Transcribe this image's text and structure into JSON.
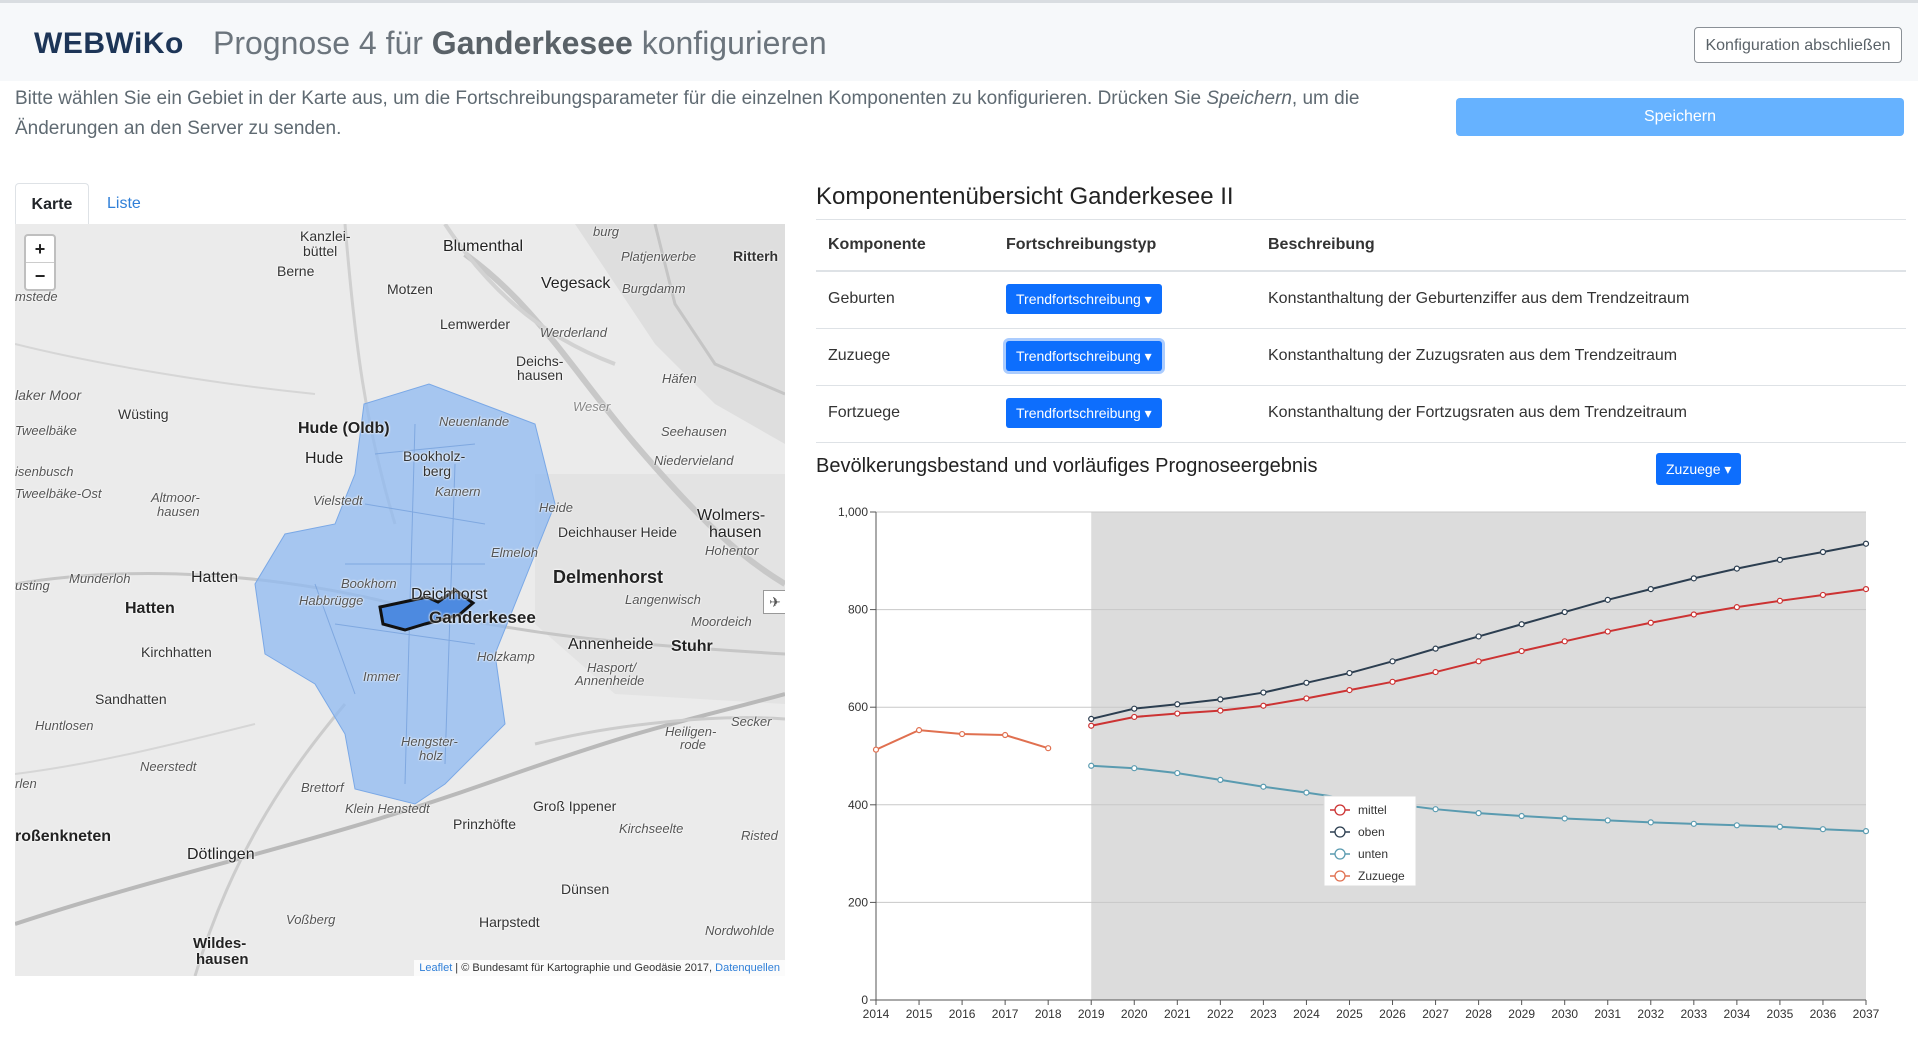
{
  "header": {
    "brand": "WEBWiKo",
    "title_prefix": "Prognose 4 für",
    "title_place": "Ganderkesee",
    "title_suffix": "konfigurieren",
    "finish_button": "Konfiguration abschließen"
  },
  "intro": {
    "line1": "Bitte wählen Sie ein Gebiet in der Karte aus, um die Fortschreibungsparameter für die einzelnen Komponenten zu konfigurieren. Drücken Sie ",
    "save_word": "Speichern",
    "line1_end": ", um die",
    "line2": "Änderungen an den Server zu senden."
  },
  "save_button": "Speichern",
  "tabs": [
    {
      "label": "Karte",
      "active": true
    },
    {
      "label": "Liste",
      "active": false
    }
  ],
  "map": {
    "zoom_in": "+",
    "zoom_out": "−",
    "labels": {
      "kanzleibuttel": "Kanzlei-",
      "kanzleibuttel2": "büttel",
      "burg": "burg",
      "blumenthal": "Blumenthal",
      "platjenwerbe": "Platjenwerbe",
      "ritterh": "Ritterh",
      "berne": "Berne",
      "motzen": "Motzen",
      "vegesack": "Vegesack",
      "burgdamm": "Burgdamm",
      "lemwerder": "Lemwerder",
      "werderland": "Werderland",
      "deichshausen1": "Deichs-",
      "deichshausen2": "hausen",
      "hafen": "Häfen",
      "weser": "Weser",
      "wusting": "Wüsting",
      "hudeoldb": "Hude (Oldb)",
      "neuenlande": "Neuenlande",
      "seehausen": "Seehausen",
      "niedervieland": "Niedervieland",
      "hude": "Hude",
      "bookholzberg1": "Bookholz-",
      "bookholzberg2": "berg",
      "kamern": "Kamern",
      "heide": "Heide",
      "wolmers1": "Wolmers-",
      "wolmers2": "hausen",
      "hohentor": "Hohentor",
      "vielstedt": "Vielstedt",
      "deichhauserheide": "Deichhauser Heide",
      "elmeloh": "Elmeloh",
      "altmoor1": "Altmoor-",
      "altmoor2": "hausen",
      "hatten": "Hatten",
      "munderloh": "Munderloh",
      "delmenhorst": "Delmenhorst",
      "bookhorn": "Bookhorn",
      "deichhorst": "Deichhorst",
      "habbrugge": "Habbrügge",
      "langenwisch": "Langenwisch",
      "ganderkesee": "Ganderkesee",
      "moordeich": "Moordeich",
      "hatten2": "Hatten",
      "annenheide": "Annenheide",
      "stuhr": "Stuhr",
      "holzkamp": "Holzkamp",
      "hasport1": "Hasport/",
      "hasport2": "Annenheide",
      "kirchhatten": "Kirchhatten",
      "immer": "Immer",
      "sandhatten": "Sandhatten",
      "huntlosen": "Huntlosen",
      "neerstedt": "Neerstedt",
      "hengster1": "Hengster-",
      "hengster2": "holz",
      "heiligenrode1": "Heiligen-",
      "heiligenrode2": "rode",
      "secker": "Secker",
      "brettorf": "Brettorf",
      "kleinhenstedt": "Klein Henstedt",
      "grossippener": "Groß Ippener",
      "rossenkneten": "roßenkneten",
      "prinzhofte": "Prinzhöfte",
      "kirchseelte": "Kirchseelte",
      "risted": "Risted",
      "dotlingen": "Dötlingen",
      "dunsen": "Dünsen",
      "vossberg": "Voßberg",
      "harpstedt": "Harpstedt",
      "nordwohlde": "Nordwohlde",
      "wildeshausen1": "Wildes-",
      "wildeshausen2": "hausen",
      "lakermoor": "laker Moor",
      "tweelbake": "Tweelbäke",
      "isenbusch": "isenbusch",
      "tweelbakeost": "Tweelbäke-Ost",
      "usting": "usting",
      "rlen": "rlen",
      "mstede": "mstede"
    },
    "attribution_link": "Leaflet",
    "attribution_text": " | © Bundesamt für Kartographie und Geodäsie 2017, ",
    "attribution_link2": "Datenquellen"
  },
  "components": {
    "title": "Komponentenübersicht Ganderkesee II",
    "headers": [
      "Komponente",
      "Fortschreibungstyp",
      "Beschreibung"
    ],
    "rows": [
      {
        "name": "Geburten",
        "type": "Trendfortschreibung",
        "description": "Konstanthaltung der Geburtenziffer aus dem Trendzeitraum"
      },
      {
        "name": "Zuzuege",
        "type": "Trendfortschreibung",
        "description": "Konstanthaltung der Zuzugsraten aus dem Trendzeitraum"
      },
      {
        "name": "Fortzuege",
        "type": "Trendfortschreibung",
        "description": "Konstanthaltung der Fortzugsraten aus dem Trendzeitraum"
      }
    ]
  },
  "chart_section": {
    "title": "Bevölkerungsbestand und vorläufiges Prognoseergebnis",
    "series_button": "Zuzuege"
  },
  "chart_data": {
    "type": "line",
    "title": "",
    "xlabel": "",
    "ylabel": "",
    "ylim": [
      0,
      1000
    ],
    "yticks": [
      0,
      200,
      400,
      600,
      800,
      1000
    ],
    "ytick_labels": [
      "0",
      "200",
      "400",
      "600",
      "800",
      "1,000"
    ],
    "x": [
      2014,
      2015,
      2016,
      2017,
      2018,
      2019,
      2020,
      2021,
      2022,
      2023,
      2024,
      2025,
      2026,
      2027,
      2028,
      2029,
      2030,
      2031,
      2032,
      2033,
      2034,
      2035,
      2036,
      2037
    ],
    "forecast_start": 2019,
    "legend_position": "center",
    "series": [
      {
        "name": "mittel",
        "color": "#cc3333",
        "x": [
          2019,
          2020,
          2021,
          2022,
          2023,
          2024,
          2025,
          2026,
          2027,
          2028,
          2029,
          2030,
          2031,
          2032,
          2033,
          2034,
          2035,
          2036,
          2037
        ],
        "values": [
          562,
          580,
          587,
          593,
          603,
          618,
          635,
          652,
          672,
          694,
          715,
          735,
          755,
          773,
          790,
          805,
          818,
          830,
          842
        ]
      },
      {
        "name": "oben",
        "color": "#2c3e50",
        "x": [
          2019,
          2020,
          2021,
          2022,
          2023,
          2024,
          2025,
          2026,
          2027,
          2028,
          2029,
          2030,
          2031,
          2032,
          2033,
          2034,
          2035,
          2036,
          2037
        ],
        "values": [
          576,
          597,
          606,
          616,
          630,
          650,
          670,
          694,
          720,
          745,
          770,
          795,
          820,
          842,
          864,
          884,
          902,
          918,
          935
        ]
      },
      {
        "name": "unten",
        "color": "#5a9bb0",
        "x": [
          2019,
          2020,
          2021,
          2022,
          2023,
          2024,
          2025,
          2026,
          2027,
          2028,
          2029,
          2030,
          2031,
          2032,
          2033,
          2034,
          2035,
          2036,
          2037
        ],
        "values": [
          480,
          475,
          465,
          451,
          437,
          425,
          412,
          402,
          391,
          383,
          377,
          372,
          368,
          364,
          361,
          358,
          355,
          350,
          346
        ]
      },
      {
        "name": "Zuzuege",
        "color": "#e07050",
        "x": [
          2014,
          2015,
          2016,
          2017,
          2018
        ],
        "values": [
          513,
          553,
          545,
          543,
          516
        ]
      }
    ]
  }
}
